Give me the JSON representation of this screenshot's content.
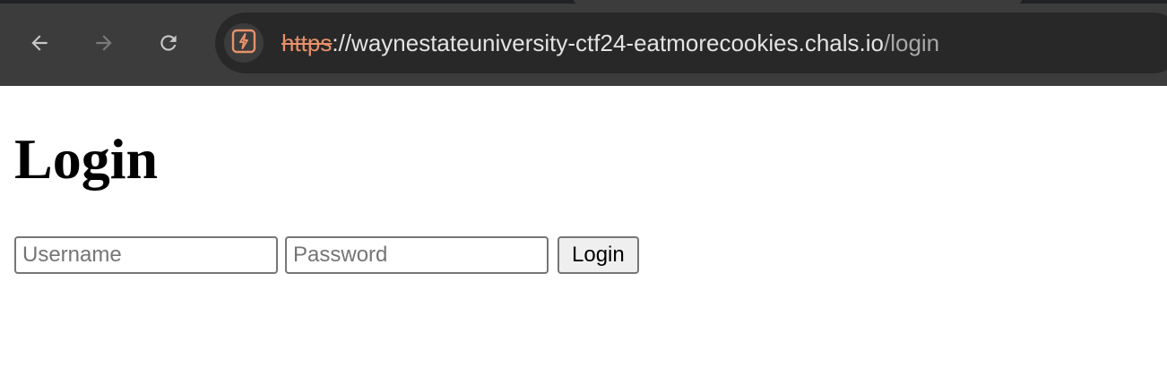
{
  "browser": {
    "url": {
      "scheme": "https",
      "separator": "://",
      "host": "waynestateuniversity-ctf24-eatmorecookies.chals.io",
      "path": "/login"
    },
    "icons": {
      "back": "arrow-left-icon",
      "forward": "arrow-right-icon",
      "reload": "reload-icon",
      "site_info": "not-secure-icon"
    },
    "colors": {
      "chrome_bg": "#3c3c3c",
      "omnibox_bg": "#282828",
      "insecure_scheme": "#e8916a"
    }
  },
  "page": {
    "heading": "Login",
    "form": {
      "username_placeholder": "Username",
      "username_value": "",
      "password_placeholder": "Password",
      "password_value": "",
      "submit_label": "Login"
    }
  }
}
